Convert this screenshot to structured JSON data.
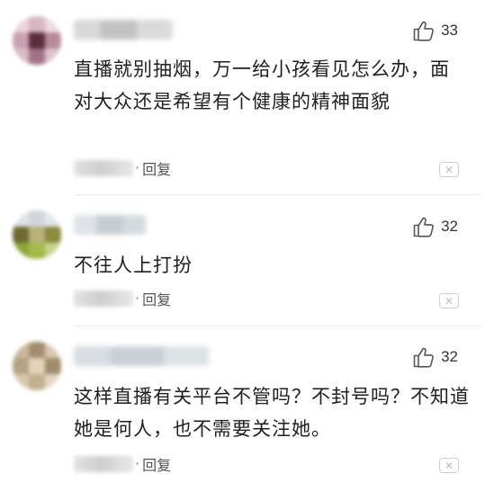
{
  "comments": [
    {
      "likes": "33",
      "text": "直播就别抽烟，万一给小孩看见怎么办，面对大众还是希望有个健康的精神面貌",
      "reply_label": "回复",
      "dot": "·",
      "close_symbol": "✕"
    },
    {
      "likes": "32",
      "text": "不往人上打扮",
      "reply_label": "回复",
      "dot": "·",
      "close_symbol": "✕"
    },
    {
      "likes": "32",
      "text": "这样直播有关平台不管吗？不封号吗？不知道她是何人，也不需要关注她。",
      "reply_label": "回复",
      "dot": "·",
      "close_symbol": "✕"
    }
  ],
  "icons": {
    "like": "thumbs-up-outline-icon",
    "close": "close-icon"
  },
  "colors": {
    "background": "#ffffff",
    "text": "#1f1f1f",
    "muted": "#888888",
    "border": "#cfcfcf"
  }
}
